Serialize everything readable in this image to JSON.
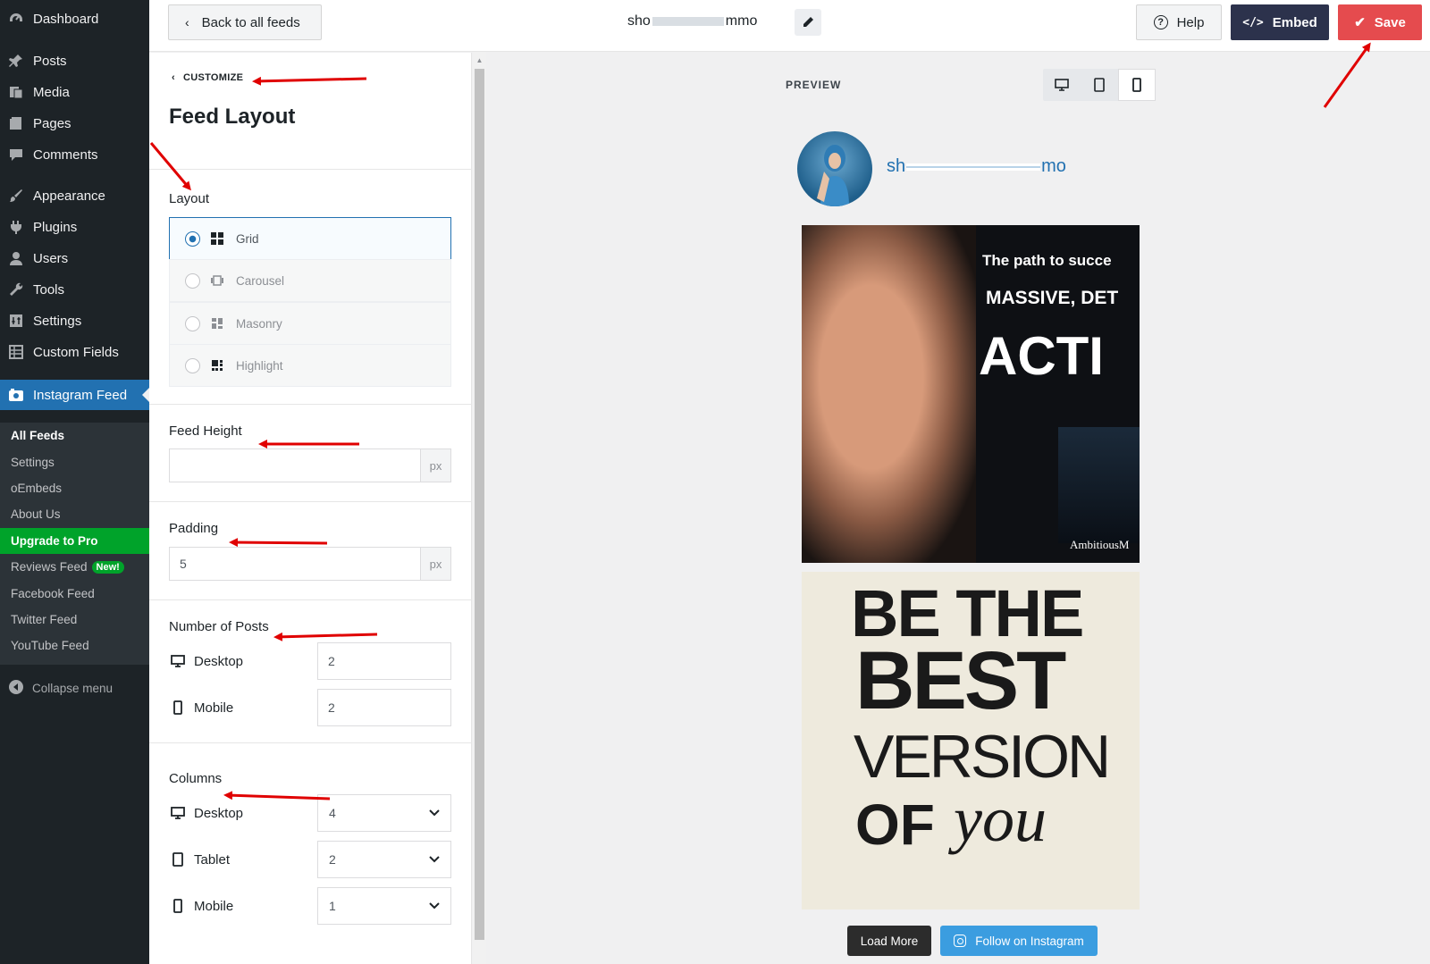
{
  "wp_menu": {
    "items": [
      {
        "label": "Dashboard",
        "icon": "dashboard-icon"
      },
      {
        "label": "Posts",
        "icon": "pin-icon"
      },
      {
        "label": "Media",
        "icon": "media-icon"
      },
      {
        "label": "Pages",
        "icon": "pages-icon"
      },
      {
        "label": "Comments",
        "icon": "comment-icon"
      },
      {
        "label": "Appearance",
        "icon": "paintbrush-icon"
      },
      {
        "label": "Plugins",
        "icon": "plugin-icon"
      },
      {
        "label": "Users",
        "icon": "user-icon"
      },
      {
        "label": "Tools",
        "icon": "wrench-icon"
      },
      {
        "label": "Settings",
        "icon": "settings-icon"
      },
      {
        "label": "Custom Fields",
        "icon": "grid-icon"
      },
      {
        "label": "Instagram Feed",
        "icon": "camera-icon"
      }
    ],
    "submenu": [
      {
        "label": "All Feeds"
      },
      {
        "label": "Settings"
      },
      {
        "label": "oEmbeds"
      },
      {
        "label": "About Us"
      },
      {
        "label": "Upgrade to Pro"
      },
      {
        "label": "Reviews Feed",
        "badge": "New!"
      },
      {
        "label": "Facebook Feed"
      },
      {
        "label": "Twitter Feed"
      },
      {
        "label": "YouTube Feed"
      }
    ],
    "collapse_label": "Collapse menu"
  },
  "topbar": {
    "back_label": "Back to all feeds",
    "feed_name_start": "sho",
    "feed_name_end": "mmo",
    "help_label": "Help",
    "embed_label": "Embed",
    "save_label": "Save"
  },
  "panel": {
    "breadcrumb": "CUSTOMIZE",
    "title": "Feed Layout",
    "layout": {
      "label": "Layout",
      "options": [
        {
          "label": "Grid",
          "selected": true
        },
        {
          "label": "Carousel",
          "selected": false
        },
        {
          "label": "Masonry",
          "selected": false
        },
        {
          "label": "Highlight",
          "selected": false
        }
      ]
    },
    "feed_height": {
      "label": "Feed Height",
      "value": "",
      "unit": "px"
    },
    "padding": {
      "label": "Padding",
      "value": "5",
      "unit": "px"
    },
    "num_posts": {
      "label": "Number of Posts",
      "desktop_label": "Desktop",
      "desktop_value": "2",
      "mobile_label": "Mobile",
      "mobile_value": "2"
    },
    "columns": {
      "label": "Columns",
      "desktop_label": "Desktop",
      "desktop_value": "4",
      "tablet_label": "Tablet",
      "tablet_value": "2",
      "mobile_label": "Mobile",
      "mobile_value": "1"
    }
  },
  "preview": {
    "label": "PREVIEW",
    "active_device": "mobile",
    "username_start": "sh",
    "username_end": "mo",
    "post1_lines": [
      "The path to succe",
      "MASSIVE, DET",
      "ACTI"
    ],
    "post1_watermark": "AmbitiousM",
    "post2_lines": [
      "BE THE",
      "BEST",
      "VERSION",
      "OF",
      "you"
    ],
    "load_more_label": "Load More",
    "follow_label": "Follow on Instagram"
  },
  "colors": {
    "wp_sidebar": "#1d2327",
    "wp_active": "#2271b1",
    "upgrade_green": "#00a32a",
    "embed_navy": "#2c324c",
    "save_red": "#e54b4e",
    "follow_blue": "#3b9de0",
    "annotation_red": "#e00000"
  }
}
